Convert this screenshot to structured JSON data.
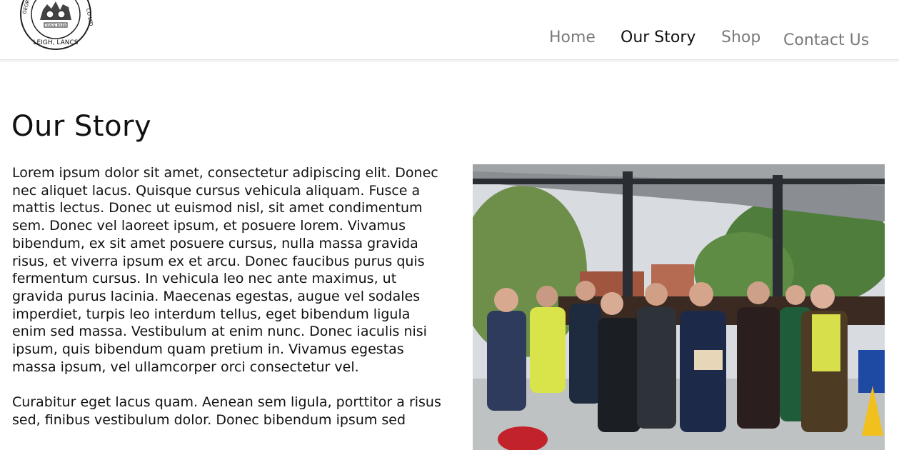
{
  "site": {
    "logo_alt": "George … Co Ltd, Leigh, Lancs",
    "logo_text_top": "GEORGE",
    "logo_text_mid": "TRADE MARK",
    "logo_text_bottom": "LEIGH, LANCS",
    "logo_text_right": "CO LTD"
  },
  "nav": {
    "items": [
      {
        "label": "Home",
        "active": false
      },
      {
        "label": "Our Story",
        "active": true
      },
      {
        "label": "Shop",
        "active": false
      },
      {
        "label": "Contact Us",
        "active": false
      }
    ]
  },
  "main": {
    "title": "Our Story",
    "paragraphs": [
      "Lorem ipsum dolor sit amet, consectetur adipiscing elit. Donec nec aliquet lacus. Quisque cursus vehicula aliquam. Fusce a mattis lectus. Donec ut euismod nisl, sit amet condimentum sem. Donec vel laoreet ipsum, et posuere lorem. Vivamus bibendum, ex sit amet posuere cursus, nulla massa gravida risus, et viverra ipsum ex et arcu. Donec faucibus purus quis fermentum cursus. In vehicula leo nec ante maximus, ut gravida purus lacinia. Maecenas egestas, augue vel sodales imperdiet, turpis leo interdum tellus, eget bibendum ligula enim sed massa. Vestibulum at enim nunc. Donec iaculis nisi ipsum, quis bibendum quam pretium in. Vivamus egestas massa ipsum, vel ullamcorper orci consectetur vel.",
      "Curabitur eget lacus quam. Aenean sem ligula, porttitor a risus sed, finibus vestibulum dolor. Donec bibendum ipsum sed"
    ],
    "photo_alt": "Group photo under a shelter"
  },
  "colors": {
    "nav_inactive": "#7a7a7a",
    "nav_active": "#111111",
    "background": "#ffffff"
  }
}
